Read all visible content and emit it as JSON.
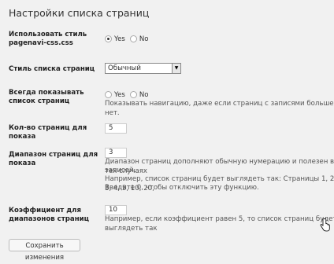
{
  "title": "Настройки списка страниц",
  "rows": {
    "css": {
      "label": "Использовать стиль pagenavi-css.css",
      "options": [
        {
          "label": "Yes",
          "checked": true
        },
        {
          "label": "No",
          "checked": false
        }
      ]
    },
    "style": {
      "label": "Стиль списка страниц",
      "value": "Обычный"
    },
    "always": {
      "label": "Всегда показывать список страниц",
      "options": [
        {
          "label": "Yes",
          "checked": false
        },
        {
          "label": "No",
          "checked": false
        }
      ],
      "desc": "Показывать навигацию, даже если страниц с записями больше нет."
    },
    "count": {
      "label": "Кол-во страниц для показа",
      "value": "5"
    },
    "range": {
      "label": "Диапазон страниц для показа",
      "value": "3",
      "desc1": "Диапазон страниц дополняют обычную нумерацию и полезен в тех случаях",
      "desc2": "записей.",
      "desc3": "Например, список страниц будет выглядеть так: Страницы 1, 2, 3, 4, 5, 10, 20,",
      "desc4": "Введите 0, чтобы отключить эту функцию."
    },
    "coef": {
      "label": "Коэффициент для диапазонов страниц",
      "value": "10",
      "desc": "Например, если коэффициент равен 5, то список страниц будет выглядеть так"
    }
  },
  "save_button": "Сохранить изменения",
  "icons": {
    "cursor": "hand-pointer-icon",
    "select_arrow": "dropdown-arrow-icon"
  }
}
